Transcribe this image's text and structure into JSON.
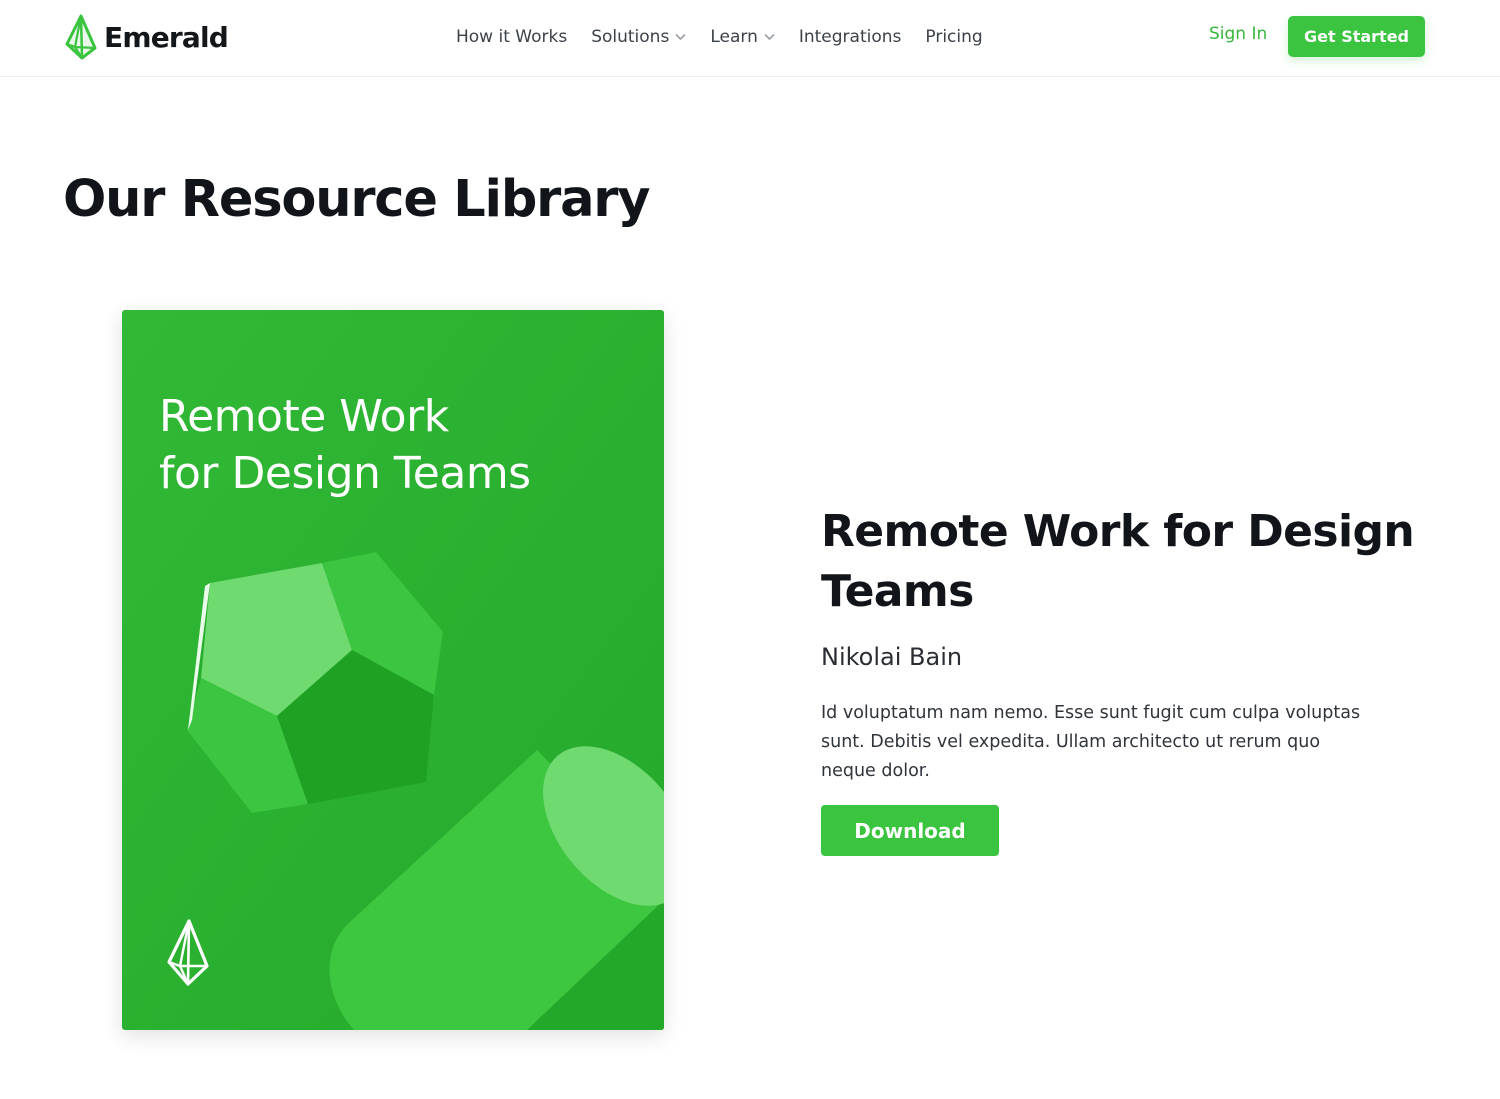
{
  "nav": {
    "brand": "Emerald",
    "links": [
      {
        "label": "How it Works",
        "dropdown": false
      },
      {
        "label": "Solutions",
        "dropdown": true
      },
      {
        "label": "Learn",
        "dropdown": true
      },
      {
        "label": "Integrations",
        "dropdown": false
      },
      {
        "label": "Pricing",
        "dropdown": false
      }
    ],
    "sign_in": "Sign In",
    "cta": "Get Started"
  },
  "page": {
    "title": "Our Resource Library"
  },
  "resource": {
    "cover_title_lines": [
      "Remote Work",
      "for Design Teams"
    ],
    "title": "Remote Work for Design Teams",
    "author": "Nikolai Bain",
    "description": "Id voluptatum nam nemo. Esse sunt fugit cum culpa voluptas sunt. Debitis vel expedita. Ullam architecto ut rerum quo neque dolor.",
    "download_label": "Download"
  },
  "colors": {
    "brand_green": "#3ac43f",
    "sign_in_green": "#35b73a",
    "cover_green": "#2bb332",
    "text_dark": "#111418"
  },
  "icons": {
    "logo": "emerald-gem-icon",
    "dropdown": "chevron-down-icon"
  }
}
